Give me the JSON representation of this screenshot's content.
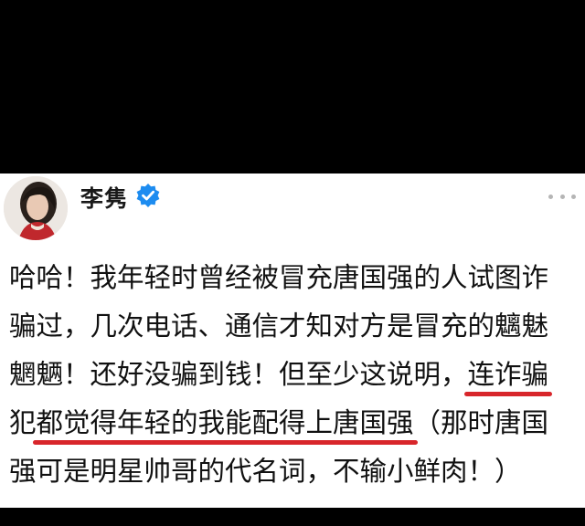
{
  "post": {
    "author": {
      "name": "李隽",
      "verified_icon": "verified-badge-icon",
      "avatar_icon": "avatar-photo"
    },
    "more_icon": "more-options-icon",
    "lines": [
      {
        "before": "哈哈！我年轻时曾经被冒充唐国强的人试图诈",
        "highlight": "",
        "after": ""
      },
      {
        "before": "骗过，几次电话、通信才知对方是冒充的魑魅",
        "highlight": "",
        "after": ""
      },
      {
        "before": "魍魉！还好没骗到钱！但至少这说明，",
        "highlight": "连诈骗",
        "after": ""
      },
      {
        "before": "犯",
        "highlight": "都觉得年轻的我能配得上唐国强",
        "after": "（那时唐国"
      },
      {
        "before": "强可是明星帅哥的代名词，不输小鲜肉！）",
        "highlight": "",
        "after": ""
      }
    ]
  },
  "colors": {
    "underline": "#d8262b",
    "verified": "#1d8cf0",
    "text": "#111111",
    "card_background": "#ffffff",
    "page_background": "#000000"
  }
}
